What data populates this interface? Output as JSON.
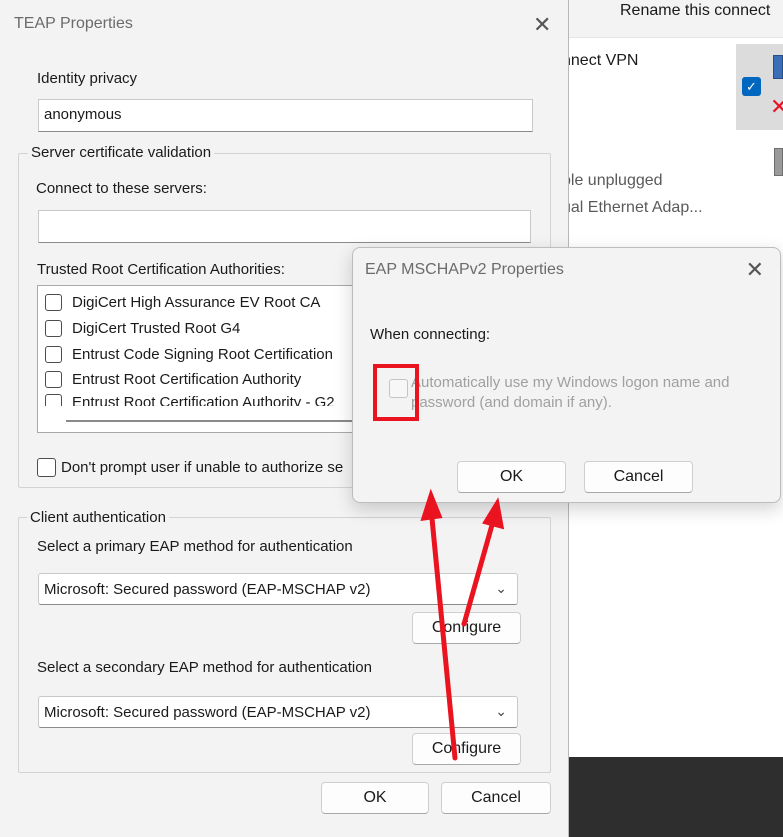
{
  "background": {
    "top_partial_text": "n",
    "rename_text": "Rename this connect",
    "vpn_text": "nnect VPN",
    "unplugged_text": "ble unplugged",
    "ethernet_text": "ual Ethernet Adap..."
  },
  "teap": {
    "title": "TEAP Properties",
    "identity_privacy_label": "Identity privacy",
    "identity_privacy_value": "anonymous",
    "server_cert_legend": "Server certificate validation",
    "connect_servers_label": "Connect to these servers:",
    "connect_servers_value": "",
    "trusted_root_label": "Trusted Root Certification Authorities:",
    "cert_items": [
      "DigiCert High Assurance EV Root CA",
      "DigiCert Trusted Root G4",
      "Entrust Code Signing Root Certification",
      "Entrust Root Certification Authority",
      "Entrust Root Certification Authority - G2"
    ],
    "dont_prompt_label": "Don't prompt user if unable to authorize se",
    "client_auth_legend": "Client authentication",
    "primary_label": "Select a primary EAP method for authentication",
    "primary_value": "Microsoft: Secured password (EAP-MSCHAP v2)",
    "configure_label": "Configure",
    "secondary_label": "Select a secondary EAP method for authentication",
    "secondary_value": "Microsoft: Secured password (EAP-MSCHAP v2)",
    "ok_label": "OK",
    "cancel_label": "Cancel"
  },
  "mschap": {
    "title": "EAP MSCHAPv2 Properties",
    "when_connecting": "When connecting:",
    "auto_logon_text": "Automatically use my Windows logon name and password (and domain if any).",
    "ok_label": "OK",
    "cancel_label": "Cancel"
  },
  "colors": {
    "annotation_red": "#ea1320",
    "accent_blue": "#0067c0"
  }
}
